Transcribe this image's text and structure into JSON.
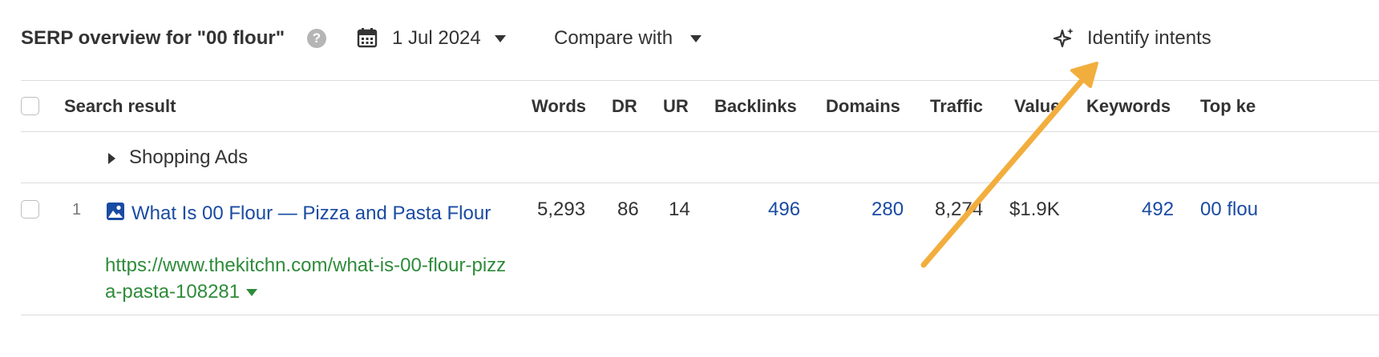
{
  "header": {
    "title": "SERP overview for \"00 flour\"",
    "help_icon": "question-circle-icon",
    "date": "1 Jul 2024",
    "compare": "Compare with",
    "identify": "Identify intents"
  },
  "table": {
    "columns": {
      "search_result": "Search result",
      "words": "Words",
      "dr": "DR",
      "ur": "UR",
      "backlinks": "Backlinks",
      "domains": "Domains",
      "traffic": "Traffic",
      "value": "Value",
      "keywords": "Keywords",
      "top_keyword": "Top ke"
    },
    "group": "Shopping Ads",
    "rows": [
      {
        "position": "1",
        "title": "What Is 00 Flour — Pizza and Pasta Flour",
        "url": "https://www.thekitchn.com/what-is-00-flour-pizza-pasta-108281",
        "words": "5,293",
        "dr": "86",
        "ur": "14",
        "backlinks": "496",
        "domains": "280",
        "traffic": "8,274",
        "value": "$1.9K",
        "keywords": "492",
        "top_keyword": "00 flou"
      }
    ]
  },
  "colors": {
    "link": "#1a4ba3",
    "url": "#2e8b3a",
    "annotation_arrow": "#f2ae3d"
  }
}
